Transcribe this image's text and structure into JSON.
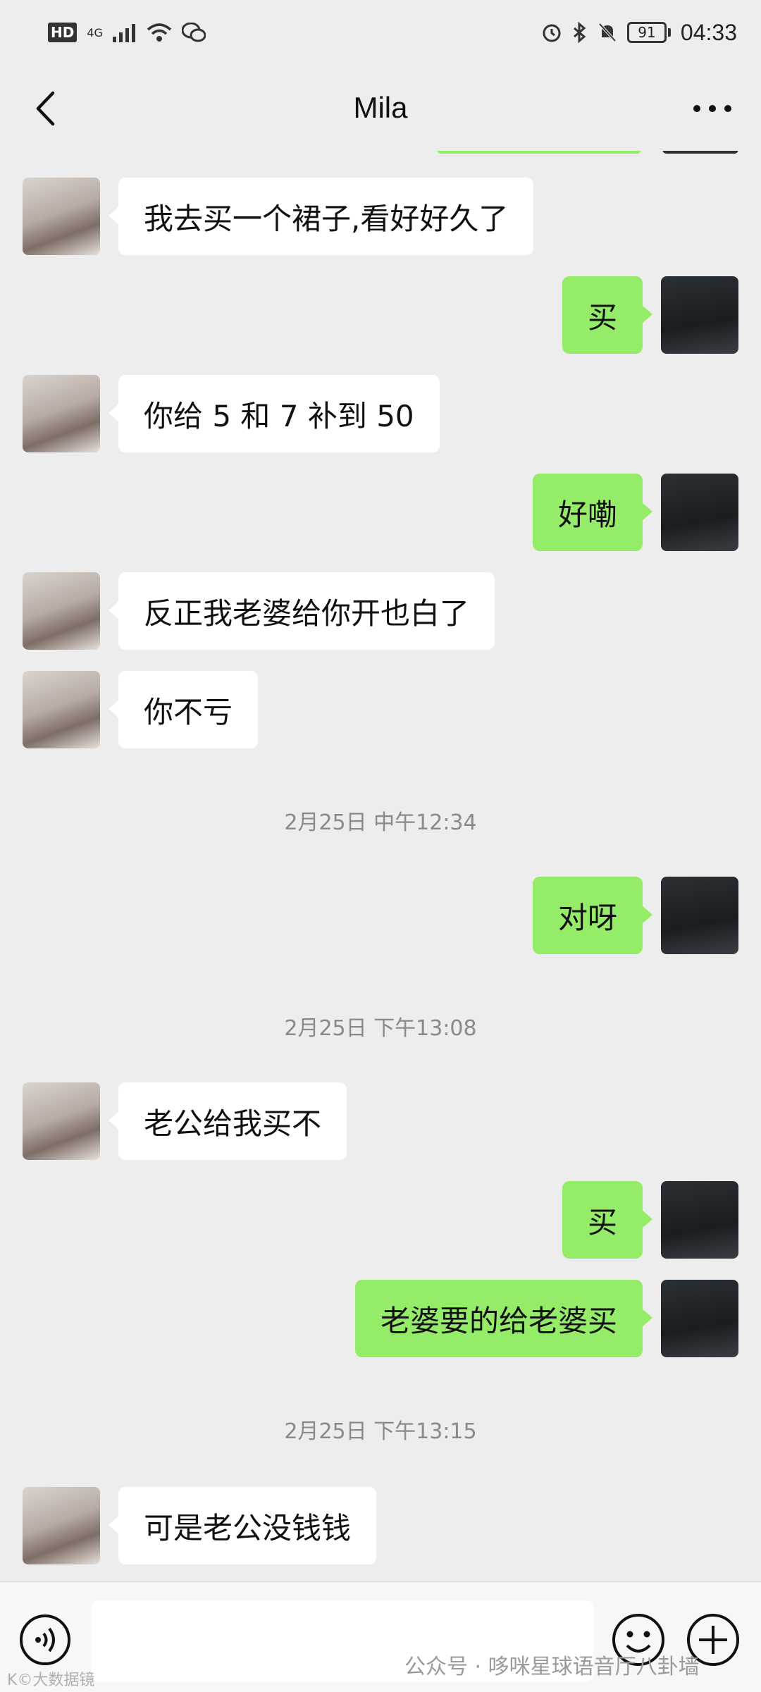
{
  "status_bar": {
    "hd": "HD",
    "network": "4G",
    "battery": "91",
    "time": "04:33"
  },
  "header": {
    "title": "Mila"
  },
  "messages": [
    {
      "side": "left",
      "text": "我去买一个裙子,看好好久了"
    },
    {
      "side": "right",
      "text": "买"
    },
    {
      "side": "left",
      "text": "你给 5 和 7 补到 50"
    },
    {
      "side": "right",
      "text": "好嘞"
    },
    {
      "side": "left",
      "text": "反正我老婆给你开也白了"
    },
    {
      "side": "left",
      "text": "你不亏"
    },
    {
      "timestamp": "2月25日 中午12:34"
    },
    {
      "side": "right",
      "text": "对呀"
    },
    {
      "timestamp": "2月25日 下午13:08"
    },
    {
      "side": "left",
      "text": "老公给我买不"
    },
    {
      "side": "right",
      "text": "买"
    },
    {
      "side": "right",
      "text": "老婆要的给老婆买"
    },
    {
      "timestamp": "2月25日 下午13:15"
    },
    {
      "side": "left",
      "text": "可是老公没钱钱"
    }
  ],
  "input_bar": {
    "placeholder": ""
  },
  "watermark": {
    "text": "公众号 · 哆咪星球语音厅八卦墙",
    "corner": "K©大数据镜"
  },
  "colors": {
    "background": "#ededed",
    "sent_bubble": "#95ec69",
    "received_bubble": "#ffffff"
  }
}
